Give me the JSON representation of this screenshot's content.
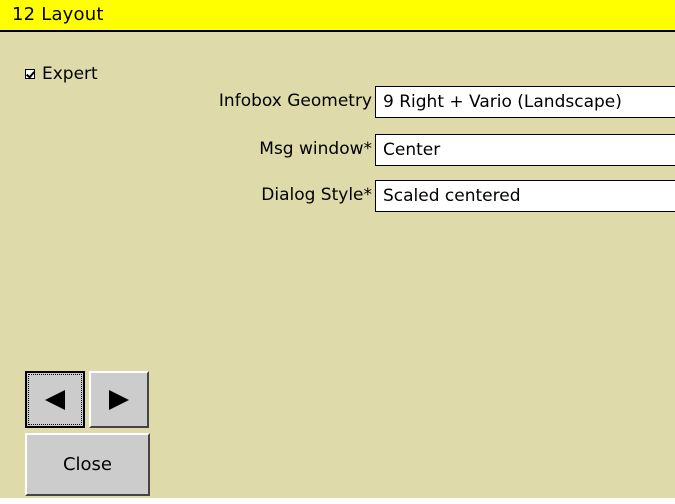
{
  "window": {
    "title": "12 Layout"
  },
  "expert": {
    "label": "Expert",
    "checked": true
  },
  "fields": [
    {
      "label": "Infobox Geometry",
      "value": "9 Right + Vario (Landscape)"
    },
    {
      "label": "Msg window*",
      "value": "Center"
    },
    {
      "label": "Dialog Style*",
      "value": "Scaled centered"
    }
  ],
  "buttons": {
    "prev_icon": "triangle-left-icon",
    "next_icon": "triangle-right-icon",
    "close_label": "Close"
  },
  "colors": {
    "title_bg": "#ffff00",
    "window_bg": "#dedaaa",
    "button_bg": "#cccccc"
  }
}
